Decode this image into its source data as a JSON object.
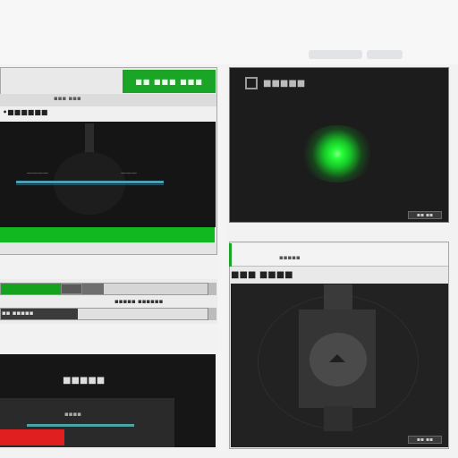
{
  "left_panel": {
    "header_button": "■■ ■■■ ■■■",
    "sub_label": "▪▪▪ ▪▪▪",
    "row_label": "•■■■■■■",
    "scope_label_left": "————",
    "scope_label_right": "———"
  },
  "mid_strip": {
    "row2_left_label": "▪▪ ▪▪▪▪▪",
    "row2_right_label": "▪▪▪▪▪ ▪▪▪▪▪▪"
  },
  "bottom_left": {
    "title": "■■■■■",
    "sub": "▪▪▪▪"
  },
  "right_top": {
    "title": "■■■■■",
    "footer": "▪▪ ▪▪"
  },
  "right_bottom": {
    "header": "▪▪▪▪▪",
    "row_label": "■■■ ■■■■",
    "footer": "▪▪ ▪▪"
  },
  "colors": {
    "accent": "#1aa526",
    "panel_dark": "#161616",
    "glow": "#28ff3c",
    "red": "#e02020",
    "teal": "#4aa6a6"
  }
}
